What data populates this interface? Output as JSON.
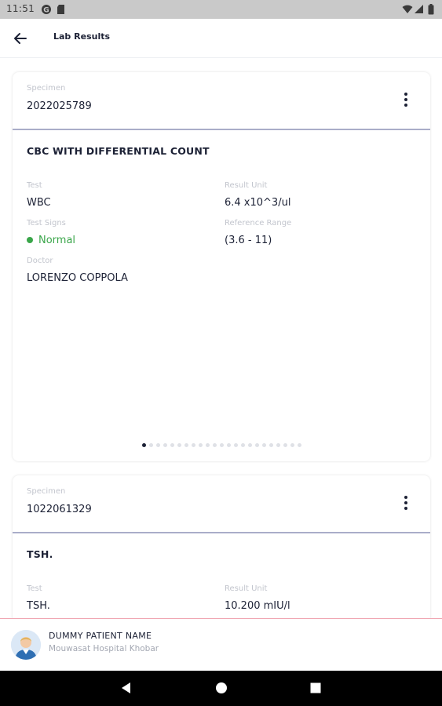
{
  "status_bar": {
    "time": "11:51"
  },
  "app_bar": {
    "title": "Lab Results"
  },
  "results": [
    {
      "specimen_label": "Specimen",
      "specimen_value": "2022025789",
      "test_group": "CBC WITH DIFFERENTIAL COUNT",
      "test_label": "Test",
      "test_value": "WBC",
      "result_unit_label": "Result Unit",
      "result_unit_value": "6.4 x10^3/ul",
      "test_signs_label": "Test Signs",
      "test_signs_value": "Normal",
      "reference_range_label": "Reference Range",
      "reference_range_value": "(3.6 - 11)",
      "doctor_label": "Doctor",
      "doctor_value": "LORENZO COPPOLA"
    },
    {
      "specimen_label": "Specimen",
      "specimen_value": "1022061329",
      "test_group": "TSH.",
      "test_label": "Test",
      "test_value": "TSH.",
      "result_unit_label": "Result Unit",
      "result_unit_value": "10.200 mIU/l"
    }
  ],
  "pager": {
    "total": 23,
    "active_index": 0
  },
  "patient": {
    "name": "DUMMY PATIENT NAME",
    "hospital": "Mouwasat Hospital Khobar"
  },
  "colors": {
    "primary_text": "#1c2135",
    "normal_status": "#3aa64a",
    "divider": "#a9adc9",
    "patient_bar_border": "#f0a7b3"
  },
  "icons": {
    "back": "arrow-left-icon",
    "more": "more-vertical-icon",
    "status_indicator": "green-dot-icon"
  }
}
